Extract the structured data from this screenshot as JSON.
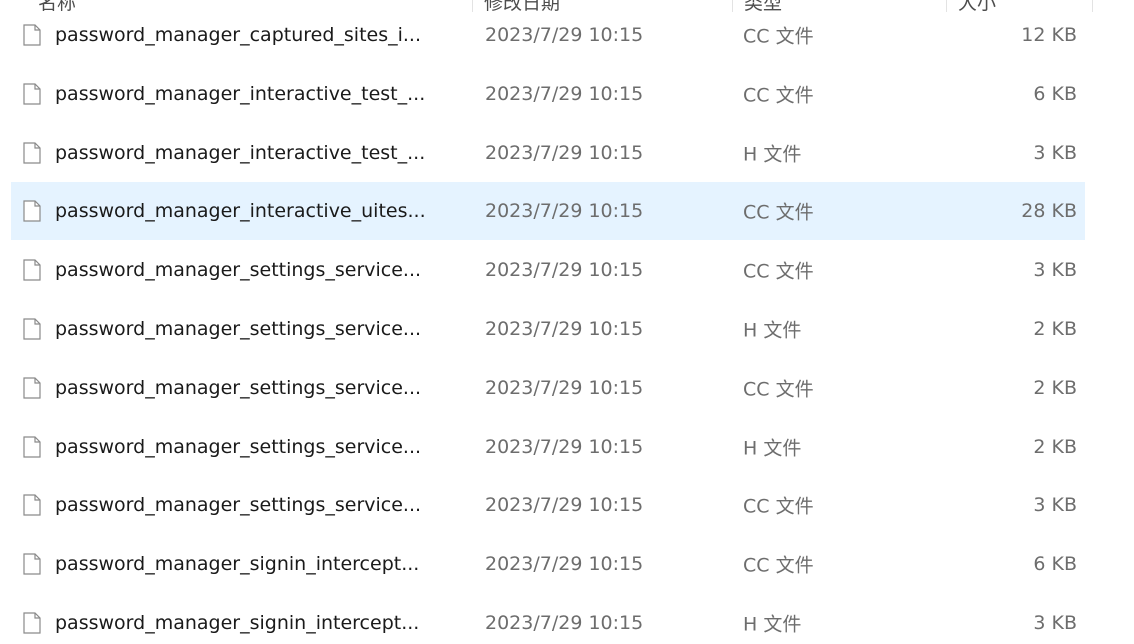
{
  "header": {
    "name": "名称",
    "date_modified": "修改日期",
    "type": "类型",
    "size": "大小"
  },
  "files": [
    {
      "name": "password_manager_captured_sites_i...",
      "date": "2023/7/29 10:15",
      "type": "CC 文件",
      "size": "12 KB",
      "selected": false
    },
    {
      "name": "password_manager_interactive_test_...",
      "date": "2023/7/29 10:15",
      "type": "CC 文件",
      "size": "6 KB",
      "selected": false
    },
    {
      "name": "password_manager_interactive_test_...",
      "date": "2023/7/29 10:15",
      "type": "H 文件",
      "size": "3 KB",
      "selected": false
    },
    {
      "name": "password_manager_interactive_uites...",
      "date": "2023/7/29 10:15",
      "type": "CC 文件",
      "size": "28 KB",
      "selected": true
    },
    {
      "name": "password_manager_settings_service...",
      "date": "2023/7/29 10:15",
      "type": "CC 文件",
      "size": "3 KB",
      "selected": false
    },
    {
      "name": "password_manager_settings_service...",
      "date": "2023/7/29 10:15",
      "type": "H 文件",
      "size": "2 KB",
      "selected": false
    },
    {
      "name": "password_manager_settings_service...",
      "date": "2023/7/29 10:15",
      "type": "CC 文件",
      "size": "2 KB",
      "selected": false
    },
    {
      "name": "password_manager_settings_service...",
      "date": "2023/7/29 10:15",
      "type": "H 文件",
      "size": "2 KB",
      "selected": false
    },
    {
      "name": "password_manager_settings_service...",
      "date": "2023/7/29 10:15",
      "type": "CC 文件",
      "size": "3 KB",
      "selected": false
    },
    {
      "name": "password_manager_signin_intercept...",
      "date": "2023/7/29 10:15",
      "type": "CC 文件",
      "size": "6 KB",
      "selected": false
    },
    {
      "name": "password_manager_signin_intercept...",
      "date": "2023/7/29 10:15",
      "type": "H 文件",
      "size": "3 KB",
      "selected": false
    }
  ],
  "icons": {
    "file": "file-icon"
  },
  "colors": {
    "selected_row": "#e5f3ff",
    "header_text": "#4d4d4d",
    "meta_text": "#6d6d6d"
  }
}
